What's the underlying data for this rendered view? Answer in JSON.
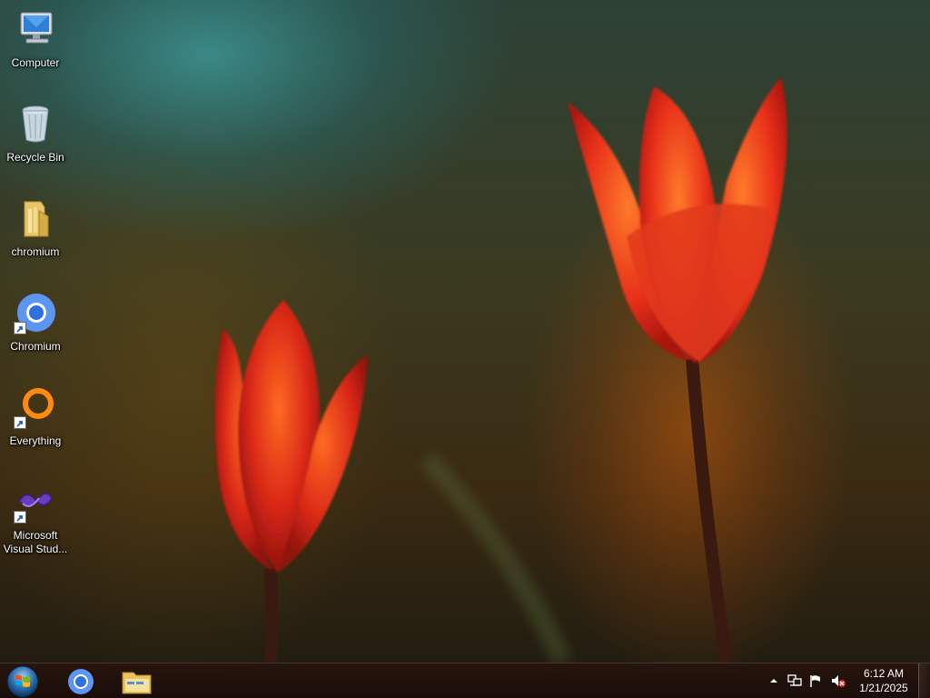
{
  "desktop": {
    "icons": [
      {
        "label": "Computer",
        "icon": "computer-icon"
      },
      {
        "label": "Recycle Bin",
        "icon": "recycle-bin-icon"
      },
      {
        "label": "chromium",
        "icon": "folder-icon"
      },
      {
        "label": "Chromium",
        "icon": "chromium-icon"
      },
      {
        "label": "Everything",
        "icon": "everything-icon"
      },
      {
        "label": "Microsoft Visual Stud...",
        "icon": "visual-studio-icon"
      }
    ]
  },
  "taskbar": {
    "start_icon": "windows-start-icon",
    "pinned": [
      {
        "icon": "chromium-icon"
      },
      {
        "icon": "file-explorer-icon"
      }
    ],
    "tray": {
      "icons": [
        "show-hidden-icons-chevron",
        "network-icon",
        "action-center-flag-icon",
        "volume-muted-icon"
      ],
      "time": "6:12 AM",
      "date": "1/21/2025"
    }
  }
}
